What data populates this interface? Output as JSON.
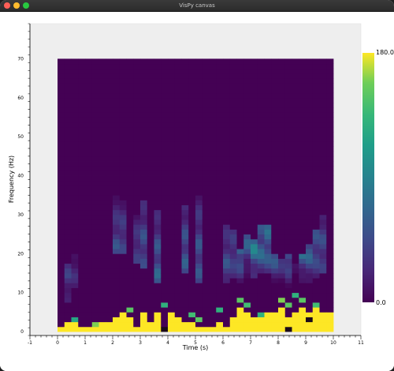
{
  "window": {
    "title": "VisPy canvas"
  },
  "chart_data": {
    "type": "heatmap",
    "xlabel": "Time (s)",
    "ylabel": "Frequency (Hz)",
    "x_range": [
      0,
      10
    ],
    "y_range": [
      0,
      70
    ],
    "x_axis_range": [
      -1,
      11
    ],
    "y_axis_range": [
      -1,
      79
    ],
    "x_ticks": [
      -1,
      0,
      1,
      2,
      3,
      4,
      5,
      6,
      7,
      8,
      9,
      10,
      11
    ],
    "y_ticks": [
      0,
      10,
      20,
      30,
      40,
      50,
      60,
      70
    ],
    "colormap": "viridis",
    "colorbar": {
      "min": 0.0,
      "max": 180.0,
      "min_label": "0.0",
      "max_label": "180.0"
    },
    "grid": false,
    "bin_duration_s": 0.25,
    "bin_bandwidth_hz": 1.25,
    "heights": [
      1,
      2,
      2,
      1,
      1,
      1,
      2,
      2,
      3,
      4,
      3,
      1,
      4,
      2,
      4,
      1,
      4,
      3,
      2,
      2,
      1,
      1,
      1,
      2,
      1,
      3,
      5,
      4,
      3,
      3,
      4,
      4,
      5,
      3,
      4,
      5,
      4,
      5,
      4,
      4,
      2,
      2,
      1,
      1,
      1,
      2,
      1,
      1,
      1,
      1,
      1,
      1,
      1,
      2,
      1,
      2,
      1,
      1,
      2,
      5,
      3,
      3,
      2,
      2,
      3,
      2,
      1,
      1,
      2,
      3,
      2,
      2,
      1,
      1,
      1,
      1,
      1,
      1
    ],
    "spots": [
      [
        2,
        2,
        120
      ],
      [
        5,
        1,
        160
      ],
      [
        10,
        4,
        150
      ],
      [
        14,
        3,
        140
      ],
      [
        15,
        5,
        130
      ],
      [
        16,
        2,
        150
      ],
      [
        19,
        3,
        140
      ],
      [
        20,
        2,
        150
      ],
      [
        23,
        4,
        130
      ],
      [
        26,
        6,
        150
      ],
      [
        27,
        5,
        140
      ],
      [
        29,
        3,
        130
      ],
      [
        32,
        6,
        160
      ],
      [
        33,
        5,
        150
      ],
      [
        34,
        7,
        130
      ],
      [
        35,
        6,
        150
      ],
      [
        37,
        5,
        140
      ],
      [
        40,
        3,
        120
      ],
      [
        52,
        2,
        120
      ],
      [
        58,
        6,
        160
      ],
      [
        59,
        5,
        130
      ],
      [
        63,
        3,
        150
      ],
      [
        66,
        2,
        140
      ],
      [
        73,
        3,
        120
      ]
    ],
    "blobs": [
      [
        1,
        6,
        10,
        8,
        45
      ],
      [
        2,
        9,
        4,
        7,
        30
      ],
      [
        8,
        16,
        3,
        12,
        60
      ],
      [
        9,
        16,
        5,
        11,
        55
      ],
      [
        11,
        14,
        5,
        10,
        50
      ],
      [
        14,
        10,
        6,
        15,
        80
      ],
      [
        12,
        13,
        8,
        14,
        65
      ],
      [
        18,
        12,
        7,
        14,
        75
      ],
      [
        20,
        10,
        9,
        18,
        70
      ],
      [
        24,
        10,
        7,
        12,
        60
      ],
      [
        25,
        11,
        9,
        10,
        55
      ],
      [
        26,
        10,
        14,
        7,
        120
      ],
      [
        26,
        11,
        17,
        6,
        110
      ],
      [
        27,
        11,
        19,
        9,
        100
      ],
      [
        28,
        11,
        13,
        8,
        115
      ],
      [
        29,
        12,
        10,
        10,
        90
      ],
      [
        30,
        12,
        12,
        10,
        95
      ],
      [
        31,
        9,
        16,
        7,
        110
      ],
      [
        32,
        8,
        19,
        7,
        95
      ],
      [
        33,
        9,
        15,
        7,
        105
      ],
      [
        34,
        8,
        20,
        6,
        90
      ],
      [
        35,
        9,
        16,
        7,
        100
      ],
      [
        36,
        10,
        14,
        8,
        95
      ],
      [
        37,
        11,
        12,
        10,
        70
      ],
      [
        38,
        12,
        9,
        12,
        60
      ],
      [
        41,
        10,
        8,
        14,
        45
      ],
      [
        45,
        12,
        6,
        16,
        40
      ],
      [
        48,
        9,
        7,
        14,
        35
      ],
      [
        58,
        12,
        10,
        6,
        110
      ],
      [
        59,
        12,
        14,
        6,
        100
      ],
      [
        60,
        11,
        12,
        8,
        130
      ],
      [
        62,
        11,
        8,
        10,
        60
      ],
      [
        67,
        11,
        7,
        12,
        50
      ],
      [
        70,
        11,
        6,
        12,
        45
      ],
      [
        72,
        10,
        5,
        10,
        40
      ]
    ],
    "dark_cells": [
      [
        15,
        0
      ],
      [
        33,
        0
      ],
      [
        36,
        2
      ]
    ]
  }
}
